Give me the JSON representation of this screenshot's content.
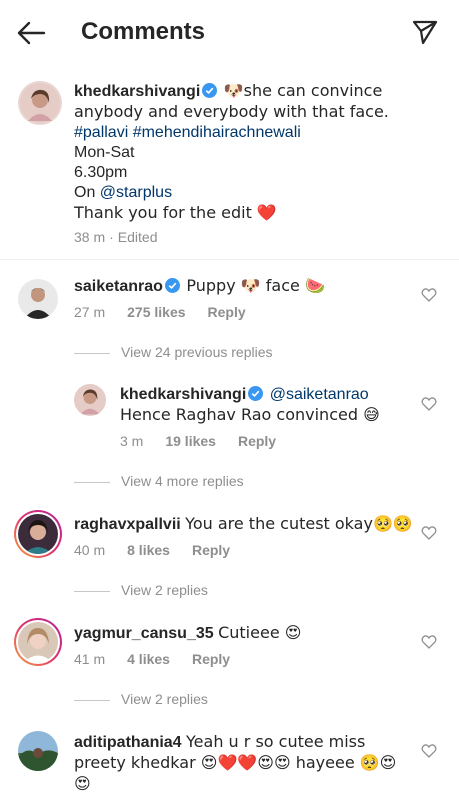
{
  "header": {
    "title": "Comments",
    "back_icon": "arrow-left-icon",
    "share_icon": "paper-plane-icon"
  },
  "caption": {
    "username": "khedkarshivangi",
    "line1": "🐶she can convince anybody and everybody with that face.",
    "hashtags": "#pallavi #mehendihairachnewali",
    "line_days": "Mon-Sat",
    "line_time": "6.30pm",
    "line_on": "On ",
    "mention": "@starplus",
    "line_thanks": "Thank you for the edit ❤️",
    "time": "38 m",
    "edited": "Edited"
  },
  "comments": [
    {
      "username": "saiketanrao",
      "text": "Puppy 🐶 face 🍉",
      "time": "27 m",
      "likes": "275 likes",
      "reply": "Reply",
      "view_prev": "View 24 previous replies",
      "reply_item": {
        "username": "khedkarshivangi",
        "mention": "@saiketanrao",
        "text": "Hence Raghav Rao convinced 😅",
        "time": "3 m",
        "likes": "19 likes",
        "reply": "Reply"
      },
      "view_more": "View 4 more replies"
    },
    {
      "username": "raghavxpallvii",
      "text": "You are the cutest okay🥺🥺",
      "time": "40 m",
      "likes": "8 likes",
      "reply": "Reply",
      "view_more": "View 2 replies"
    },
    {
      "username": "yagmur_cansu_35",
      "text": "Cutieee 😍",
      "time": "41 m",
      "likes": "4 likes",
      "reply": "Reply",
      "view_more": "View 2 replies"
    },
    {
      "username": "aditipathania4",
      "text1": "Yeah u r so cutee miss",
      "text2": "preety khedkar 😍❤️❤️😍😍 hayeee 🥺😍",
      "text3": "😍"
    }
  ],
  "colors": {
    "text": "#262626",
    "secondary": "#8e8e8e",
    "link": "#00376b",
    "verified": "#3897f0"
  }
}
